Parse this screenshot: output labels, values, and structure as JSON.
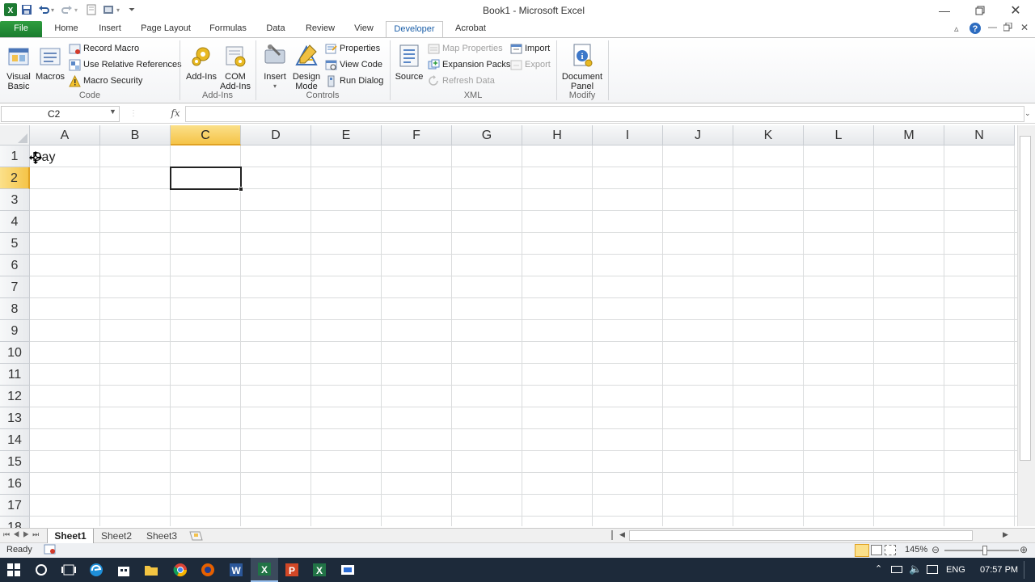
{
  "window": {
    "title": "Book1 - Microsoft Excel",
    "minimize_icon": "minimize-icon",
    "restore_icon": "restore-icon",
    "close_icon": "close-icon"
  },
  "quick_access": [
    "excel-logo-icon",
    "save-icon",
    "undo-icon",
    "redo-icon",
    "print-preview-icon",
    "customize-qat-icon"
  ],
  "tabs": [
    {
      "label": "File"
    },
    {
      "label": "Home"
    },
    {
      "label": "Insert"
    },
    {
      "label": "Page Layout"
    },
    {
      "label": "Formulas"
    },
    {
      "label": "Data"
    },
    {
      "label": "Review"
    },
    {
      "label": "View"
    },
    {
      "label": "Developer"
    },
    {
      "label": "Acrobat"
    }
  ],
  "active_tab": "Developer",
  "ribbon": {
    "code": {
      "label": "Code",
      "visual_basic": "Visual Basic",
      "macros": "Macros",
      "record_macro": "Record Macro",
      "relative_refs": "Use Relative References",
      "macro_security": "Macro Security"
    },
    "addins": {
      "label": "Add-Ins",
      "addins": "Add-Ins",
      "com_addins": "COM Add-Ins"
    },
    "controls": {
      "label": "Controls",
      "insert": "Insert",
      "design_mode": "Design Mode",
      "properties": "Properties",
      "view_code": "View Code",
      "run_dialog": "Run Dialog"
    },
    "xml": {
      "label": "XML",
      "source": "Source",
      "map_properties": "Map Properties",
      "expansion_packs": "Expansion Packs",
      "refresh_data": "Refresh Data",
      "import": "Import",
      "export": "Export"
    },
    "modify": {
      "label": "Modify",
      "document_panel": "Document Panel"
    }
  },
  "formula_bar": {
    "name_box": "C2",
    "fx": "fx",
    "formula": ""
  },
  "sheet": {
    "columns": [
      "A",
      "B",
      "C",
      "D",
      "E",
      "F",
      "G",
      "H",
      "I",
      "J",
      "K",
      "L",
      "M",
      "N"
    ],
    "rows": [
      "1",
      "2",
      "3",
      "4",
      "5",
      "6",
      "7",
      "8",
      "9",
      "10",
      "11",
      "12",
      "13",
      "14",
      "15",
      "16",
      "17",
      "18"
    ],
    "selected_column": "C",
    "selected_row": "2",
    "cells": {
      "A1": "Day"
    }
  },
  "sheet_tabs": [
    "Sheet1",
    "Sheet2",
    "Sheet3"
  ],
  "active_sheet": "Sheet1",
  "status": {
    "mode": "Ready",
    "zoom": "145%"
  },
  "taskbar": {
    "language": "ENG",
    "time": "07:57 PM"
  },
  "colors": {
    "excel_green": "#1d7a32",
    "selection_header": "#f5c448",
    "taskbar": "#1d2a3a"
  }
}
